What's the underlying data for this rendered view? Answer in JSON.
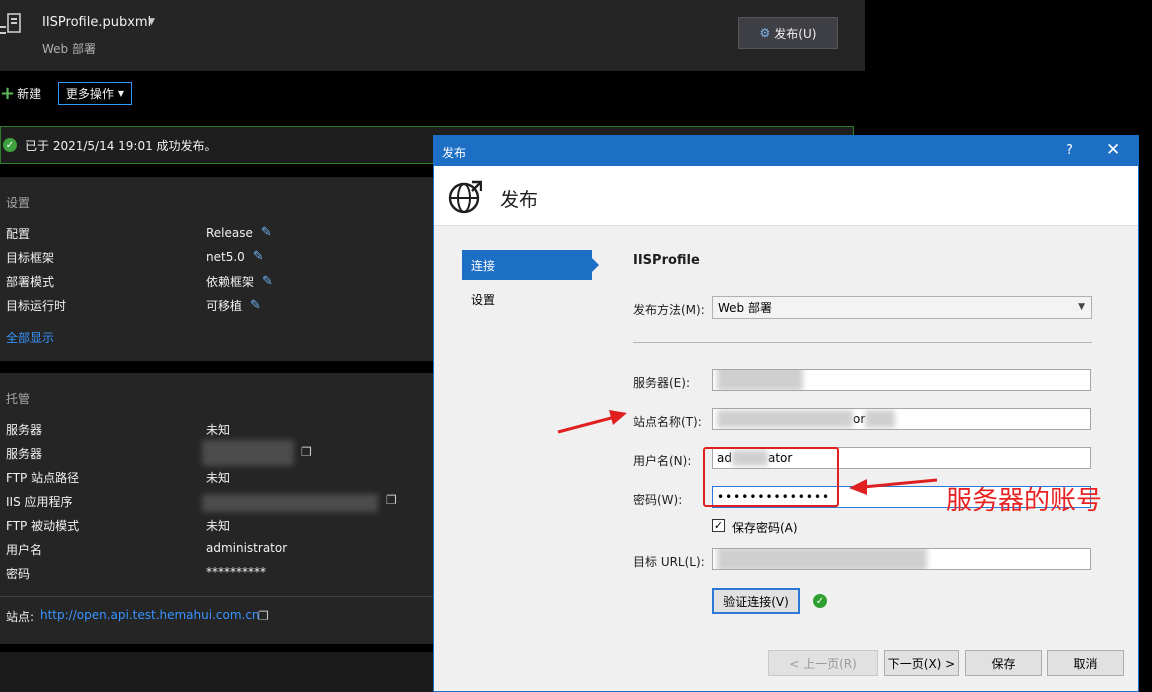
{
  "header": {
    "filename": "IISProfile.pubxml",
    "subtitle": "Web 部署",
    "publish_button": "发布(U)"
  },
  "toolbar": {
    "new_label": "新建",
    "more_label": "更多操作"
  },
  "status": {
    "message": "已于 2021/5/14 19:01 成功发布。"
  },
  "settings": {
    "title": "设置",
    "rows": [
      {
        "label": "配置",
        "value": "Release"
      },
      {
        "label": "目标框架",
        "value": "net5.0"
      },
      {
        "label": "部署模式",
        "value": "依赖框架"
      },
      {
        "label": "目标运行时",
        "value": "可移植"
      }
    ],
    "show_all": "全部显示"
  },
  "hosting": {
    "title": "托管",
    "rows": [
      {
        "label": "服务器",
        "value": "未知"
      },
      {
        "label": "服务器",
        "value": ""
      },
      {
        "label": "FTP 站点路径",
        "value": "未知"
      },
      {
        "label": "IIS 应用程序",
        "value": ""
      },
      {
        "label": "FTP 被动模式",
        "value": "未知"
      },
      {
        "label": "用户名",
        "value": "administrator"
      },
      {
        "label": "密码",
        "value": "**********"
      }
    ],
    "site_label": "站点:",
    "site_url": "http://open.api.test.hemahui.com.cn"
  },
  "dialog": {
    "window_title": "发布",
    "help": "?",
    "close": "✕",
    "heading": "发布",
    "nav": {
      "connect": "连接",
      "settings": "设置"
    },
    "profile_name": "IISProfile",
    "method_label": "发布方法(M):",
    "method_value": "Web 部署",
    "server_label": "服务器(E):",
    "site_name_label": "站点名称(T):",
    "site_name_tail": "or",
    "username_label": "用户名(N):",
    "username_prefix": "ad",
    "username_suffix": "ator",
    "password_label": "密码(W):",
    "password_value": "••••••••••••••",
    "save_password": "保存密码(A)",
    "target_url_label": "目标 URL(L):",
    "verify_button": "验证连接(V)",
    "buttons": {
      "prev": "< 上一页(R)",
      "next": "下一页(X) >",
      "save": "保存",
      "cancel": "取消"
    }
  },
  "annotation": {
    "text": "服务器的账号",
    "color": "#e82222"
  },
  "colors": {
    "accent": "#1c6fc5",
    "success": "#3ea03e",
    "link": "#3794ff"
  }
}
